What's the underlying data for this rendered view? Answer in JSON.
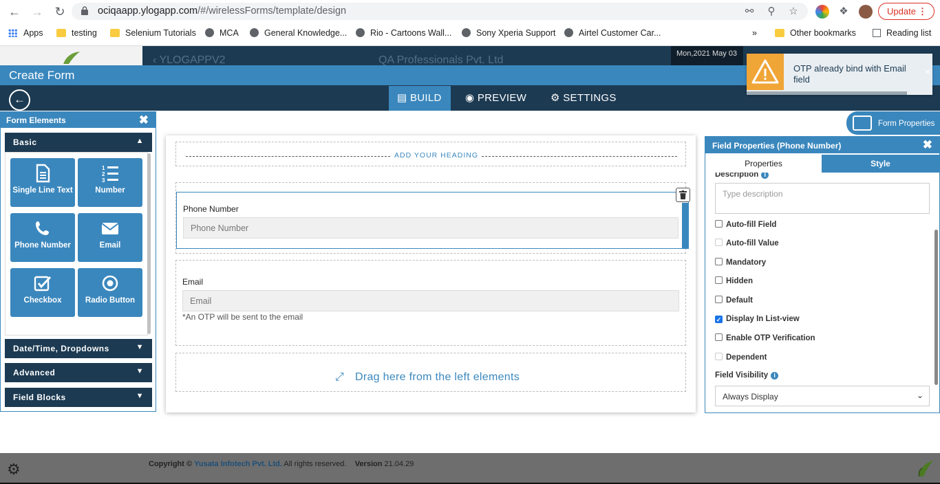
{
  "browser": {
    "url_host": "ociqaapp.ylogapp.com",
    "url_path": "/#/wirelessForms/template/design",
    "update_label": "Update",
    "bookmarks": [
      {
        "label": "Apps",
        "icon": "apps-grid-icon"
      },
      {
        "label": "testing",
        "icon": "folder-icon"
      },
      {
        "label": "Selenium Tutorials",
        "icon": "folder-icon"
      },
      {
        "label": "MCA",
        "icon": "globe-icon"
      },
      {
        "label": "General Knowledge...",
        "icon": "globe-icon"
      },
      {
        "label": "Rio - Cartoons Wall...",
        "icon": "globe-icon"
      },
      {
        "label": "Sony Xperia Support",
        "icon": "globe-icon"
      },
      {
        "label": "Airtel Customer Car...",
        "icon": "globe-icon"
      }
    ],
    "more_bookmarks": "»",
    "other_bookmarks": "Other bookmarks",
    "reading_list": "Reading list"
  },
  "app_header": {
    "app_name": "YLOGAPPV2",
    "org_name": "QA Professionals Pvt. Ltd",
    "date": "Mon,2021 May 03"
  },
  "create_form": {
    "title": "Create Form"
  },
  "tabs": [
    {
      "label": "BUILD",
      "icon": "build-icon",
      "active": true
    },
    {
      "label": "PREVIEW",
      "icon": "eye-icon",
      "active": false
    },
    {
      "label": "SETTINGS",
      "icon": "gear-icon",
      "active": false
    }
  ],
  "toast": {
    "message": "OTP already bind with Email field",
    "close": "×"
  },
  "form_elements": {
    "title": "Form Elements",
    "sections": {
      "basic": "Basic",
      "datetime": "Date/Time, Dropdowns",
      "advanced": "Advanced",
      "field_blocks": "Field Blocks"
    },
    "tiles": [
      {
        "label": "Single Line Text",
        "icon": "document-icon"
      },
      {
        "label": "Number",
        "icon": "numbered-list-icon"
      },
      {
        "label": "Phone Number",
        "icon": "phone-icon"
      },
      {
        "label": "Email",
        "icon": "envelope-icon"
      },
      {
        "label": "Checkbox",
        "icon": "checkbox-icon"
      },
      {
        "label": "Radio Button",
        "icon": "radio-icon"
      }
    ]
  },
  "canvas": {
    "heading_placeholder": "ADD YOUR HEADING",
    "phone_field": {
      "label": "Phone Number",
      "placeholder": "Phone Number"
    },
    "email_field": {
      "label": "Email",
      "placeholder": "Email",
      "note": "*An OTP will be sent to the email"
    },
    "drop_zone": "Drag here from the left elements"
  },
  "form_properties": {
    "label": "Form Properties"
  },
  "field_properties": {
    "title": "Field Properties (Phone Number)",
    "tabs": [
      "Properties",
      "Style"
    ],
    "description_label": "Description",
    "description_placeholder": "Type description",
    "checkboxes": [
      {
        "label": "Auto-fill Field",
        "checked": false,
        "disabled": false
      },
      {
        "label": "Auto-fill Value",
        "checked": false,
        "disabled": true
      },
      {
        "label": "Mandatory",
        "checked": false,
        "disabled": false
      },
      {
        "label": "Hidden",
        "checked": false,
        "disabled": false
      },
      {
        "label": "Default",
        "checked": false,
        "disabled": false
      },
      {
        "label": "Display In List-view",
        "checked": true,
        "disabled": false
      },
      {
        "label": "Enable OTP Verification",
        "checked": false,
        "disabled": false
      },
      {
        "label": "Dependent",
        "checked": false,
        "disabled": true
      }
    ],
    "visibility_label": "Field Visibility",
    "visibility_value": "Always Display"
  },
  "footer": {
    "copyright_prefix": "Copyright ©",
    "company": "Yusata Infotech Pvt. Ltd.",
    "rights": "All rights reserved.",
    "version_label": "Version",
    "version": "21.04.29"
  },
  "colors": {
    "primary": "#3a87bd",
    "dark": "#1c3a52",
    "warning": "#f0a537"
  }
}
